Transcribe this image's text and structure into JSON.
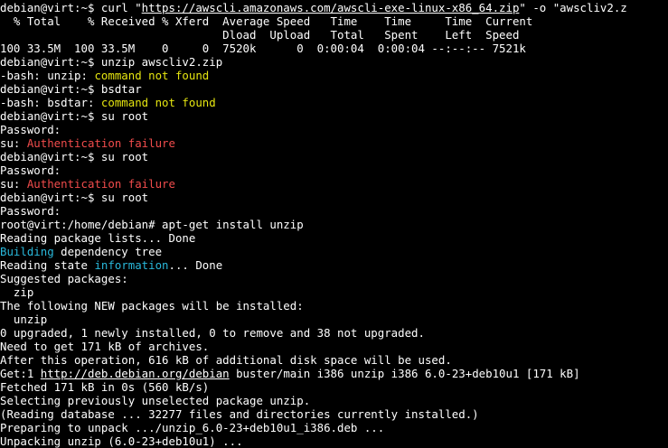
{
  "colors": {
    "background": "#000000",
    "default": "#ffffff",
    "yellow": "#e5e510",
    "red": "#f14c4c",
    "cyan": "#29b8db"
  },
  "lines": [
    [
      {
        "t": "debian@virt:~$ curl \""
      },
      {
        "t": "https://awscli.amazonaws.com/awscli-exe-linux-x86_64.zip",
        "link": true
      },
      {
        "t": "\" -o \"awscliv2.z"
      }
    ],
    [
      {
        "t": "  % Total    % Received % Xferd  Average Speed   Time    Time     Time  Current"
      }
    ],
    [
      {
        "t": "                                 Dload  Upload   Total   Spent    Left  Speed"
      }
    ],
    [
      {
        "t": "100 33.5M  100 33.5M    0     0  7520k      0  0:00:04  0:00:04 --:--:-- 7521k"
      }
    ],
    [
      {
        "t": "debian@virt:~$ unzip awscliv2.zip"
      }
    ],
    [
      {
        "t": "-bash: unzip: "
      },
      {
        "t": "command not found",
        "c": "yellow"
      }
    ],
    [
      {
        "t": "debian@virt:~$ bsdtar"
      }
    ],
    [
      {
        "t": "-bash: bsdtar: "
      },
      {
        "t": "command not found",
        "c": "yellow"
      }
    ],
    [
      {
        "t": "debian@virt:~$ su root"
      }
    ],
    [
      {
        "t": "Password:"
      }
    ],
    [
      {
        "t": "su: "
      },
      {
        "t": "Authentication failure",
        "c": "red"
      }
    ],
    [
      {
        "t": "debian@virt:~$ su root"
      }
    ],
    [
      {
        "t": "Password:"
      }
    ],
    [
      {
        "t": "su: "
      },
      {
        "t": "Authentication failure",
        "c": "red"
      }
    ],
    [
      {
        "t": "debian@virt:~$ su root"
      }
    ],
    [
      {
        "t": "Password:"
      }
    ],
    [
      {
        "t": "root@virt:/home/debian# apt-get install unzip"
      }
    ],
    [
      {
        "t": "Reading package lists... Done"
      }
    ],
    [
      {
        "t": "Building",
        "c": "cyan"
      },
      {
        "t": " dependency tree"
      }
    ],
    [
      {
        "t": "Reading state "
      },
      {
        "t": "information",
        "c": "cyan"
      },
      {
        "t": "... Done"
      }
    ],
    [
      {
        "t": "Suggested packages:"
      }
    ],
    [
      {
        "t": "  zip"
      }
    ],
    [
      {
        "t": "The following NEW packages will be installed:"
      }
    ],
    [
      {
        "t": "  unzip"
      }
    ],
    [
      {
        "t": "0 upgraded, 1 newly installed, 0 to remove and 38 not upgraded."
      }
    ],
    [
      {
        "t": "Need to get 171 kB of archives."
      }
    ],
    [
      {
        "t": "After this operation, 616 kB of additional disk space will be used."
      }
    ],
    [
      {
        "t": "Get:1 "
      },
      {
        "t": "http://deb.debian.org/debian",
        "link": true
      },
      {
        "t": " buster/main i386 unzip i386 6.0-23+deb10u1 [171 kB]"
      }
    ],
    [
      {
        "t": "Fetched 171 kB in 0s (560 kB/s)"
      }
    ],
    [
      {
        "t": "Selecting previously unselected package unzip."
      }
    ],
    [
      {
        "t": "(Reading database ... 32277 files and directories currently installed.)"
      }
    ],
    [
      {
        "t": "Preparing to unpack .../unzip_6.0-23+deb10u1_i386.deb ..."
      }
    ],
    [
      {
        "t": "Unpacking unzip (6.0-23+deb10u1) ..."
      }
    ]
  ]
}
